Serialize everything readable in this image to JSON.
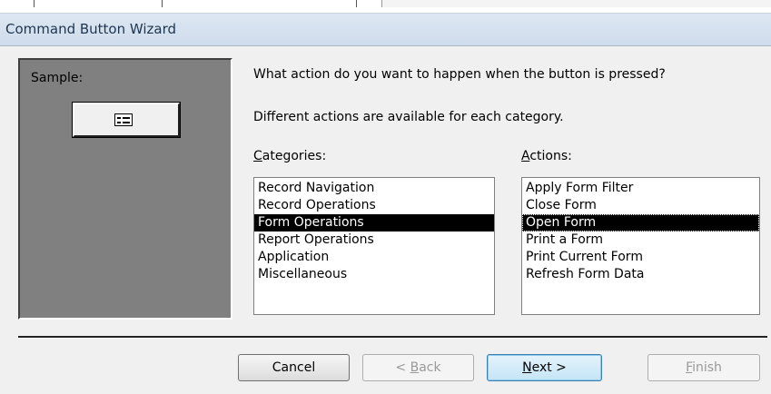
{
  "window": {
    "title": "Command Button Wizard"
  },
  "sample": {
    "label": "Sample:",
    "button_icon": "form-icon"
  },
  "prompt": {
    "question": "What action do you want to happen when the button is pressed?",
    "info": "Different actions are available for each category."
  },
  "categories": {
    "label_first": "C",
    "label_rest": "ategories:",
    "items": [
      {
        "label": "Record Navigation"
      },
      {
        "label": "Record Operations"
      },
      {
        "label": "Form Operations"
      },
      {
        "label": "Report Operations"
      },
      {
        "label": "Application"
      },
      {
        "label": "Miscellaneous"
      }
    ],
    "selected_index": 2
  },
  "actions": {
    "label_first": "A",
    "label_rest": "ctions:",
    "items": [
      {
        "label": "Apply Form Filter"
      },
      {
        "label": "Close Form"
      },
      {
        "label": "Open Form"
      },
      {
        "label": "Print a Form"
      },
      {
        "label": "Print Current Form"
      },
      {
        "label": "Refresh Form Data"
      }
    ],
    "selected_index": 2
  },
  "buttons": {
    "cancel": "Cancel",
    "back_prefix": "< ",
    "back_access": "B",
    "back_rest": "ack",
    "next_access": "N",
    "next_rest": "ext >",
    "finish_access": "F",
    "finish_rest": "inish"
  }
}
